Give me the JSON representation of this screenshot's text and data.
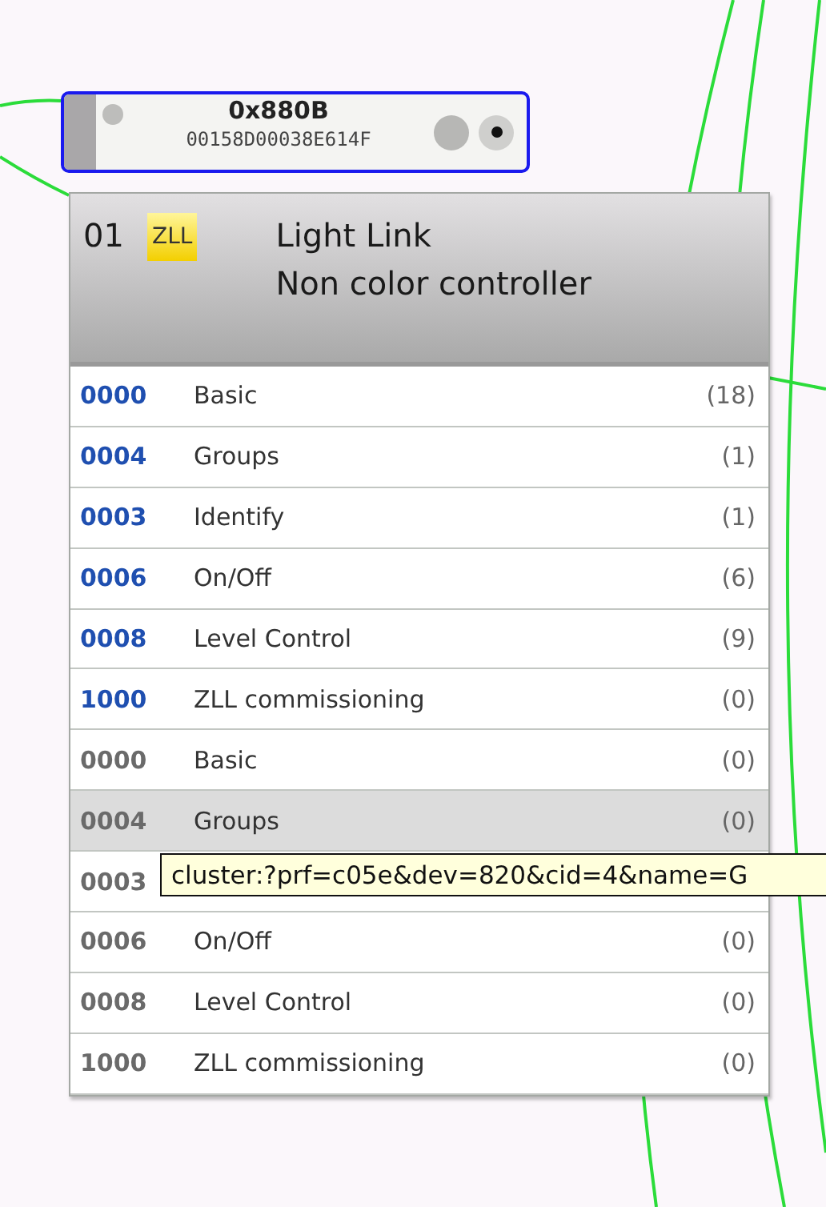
{
  "node": {
    "address": "0x880B",
    "mac": "00158D00038E614F"
  },
  "endpoint": {
    "number": "01",
    "profile_badge": "ZLL",
    "profile": "Light Link",
    "device": "Non color controller"
  },
  "clusters": [
    {
      "id": "0000",
      "name": "Basic",
      "count": "(18)",
      "kind": "server",
      "selected": false
    },
    {
      "id": "0004",
      "name": "Groups",
      "count": "(1)",
      "kind": "server",
      "selected": false
    },
    {
      "id": "0003",
      "name": "Identify",
      "count": "(1)",
      "kind": "server",
      "selected": false
    },
    {
      "id": "0006",
      "name": "On/Off",
      "count": "(6)",
      "kind": "server",
      "selected": false
    },
    {
      "id": "0008",
      "name": "Level Control",
      "count": "(9)",
      "kind": "server",
      "selected": false
    },
    {
      "id": "1000",
      "name": "ZLL commissioning",
      "count": "(0)",
      "kind": "server",
      "selected": false
    },
    {
      "id": "0000",
      "name": "Basic",
      "count": "(0)",
      "kind": "client",
      "selected": false
    },
    {
      "id": "0004",
      "name": "Groups",
      "count": "(0)",
      "kind": "client",
      "selected": true
    },
    {
      "id": "0003",
      "kind": "client",
      "selected": false
    },
    {
      "id": "0006",
      "name": "On/Off",
      "count": "(0)",
      "kind": "client",
      "selected": false
    },
    {
      "id": "0008",
      "name": "Level Control",
      "count": "(0)",
      "kind": "client",
      "selected": false
    },
    {
      "id": "1000",
      "name": "ZLL commissioning",
      "count": "(0)",
      "kind": "client",
      "selected": false
    }
  ],
  "tooltip": "cluster:?prf=c05e&dev=820&cid=4&name=G"
}
